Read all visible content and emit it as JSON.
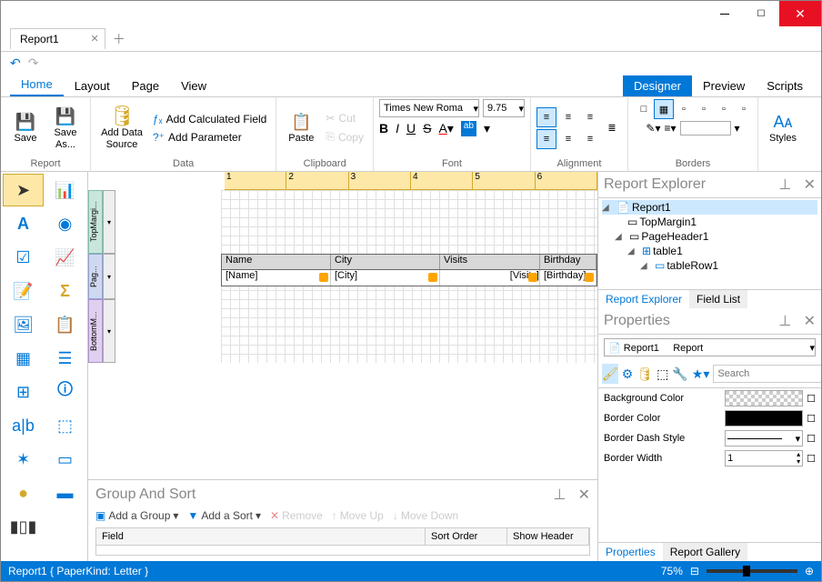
{
  "window": {
    "tab_title": "Report1"
  },
  "ribbon_tabs": [
    "Home",
    "Layout",
    "Page",
    "View"
  ],
  "ribbon_right": [
    "Designer",
    "Preview",
    "Scripts"
  ],
  "ribbon": {
    "report": {
      "save": "Save",
      "save_as": "Save\nAs...",
      "add_ds": "Add Data\nSource",
      "label": "Report"
    },
    "data": {
      "calc_field": "Add Calculated Field",
      "add_param": "Add Parameter",
      "label": "Data"
    },
    "clipboard": {
      "paste": "Paste",
      "cut": "Cut",
      "copy": "Copy",
      "label": "Clipboard"
    },
    "font": {
      "name": "Times New Roma",
      "size": "9.75",
      "label": "Font"
    },
    "alignment": {
      "label": "Alignment"
    },
    "borders": {
      "label": "Borders"
    },
    "styles": {
      "label": "Styles"
    }
  },
  "design": {
    "ruler_ticks": [
      "1",
      "2",
      "3",
      "4",
      "5",
      "6"
    ],
    "bands": {
      "top": "TopMargi...",
      "header": "PageHea...",
      "bottom": "BottomM..."
    },
    "table_headers": [
      "Name",
      "City",
      "Visits",
      "Birthday"
    ],
    "table_fields": [
      "[Name]",
      "[City]",
      "[Visits]",
      "[Birthday]"
    ]
  },
  "group_sort": {
    "title": "Group And Sort",
    "add_group": "Add a Group",
    "add_sort": "Add a Sort",
    "remove": "Remove",
    "move_up": "Move Up",
    "move_down": "Move Down",
    "cols": [
      "Field",
      "Sort Order",
      "Show Header"
    ]
  },
  "explorer": {
    "title": "Report Explorer",
    "nodes": {
      "root": "Report1",
      "tm": "TopMargin1",
      "ph": "PageHeader1",
      "t1": "table1",
      "tr1": "tableRow1"
    },
    "tabs": [
      "Report Explorer",
      "Field List"
    ]
  },
  "properties": {
    "title": "Properties",
    "obj": "Report1",
    "type": "Report",
    "search_ph": "Search",
    "rows": [
      {
        "name": "Background Color",
        "kind": "checker"
      },
      {
        "name": "Border Color",
        "kind": "black"
      },
      {
        "name": "Border Dash Style",
        "kind": "line-dd"
      },
      {
        "name": "Border Width",
        "kind": "num",
        "val": "1"
      }
    ],
    "tabs": [
      "Properties",
      "Report Gallery"
    ]
  },
  "status": {
    "text": "Report1 { PaperKind: Letter }",
    "zoom": "75%"
  }
}
